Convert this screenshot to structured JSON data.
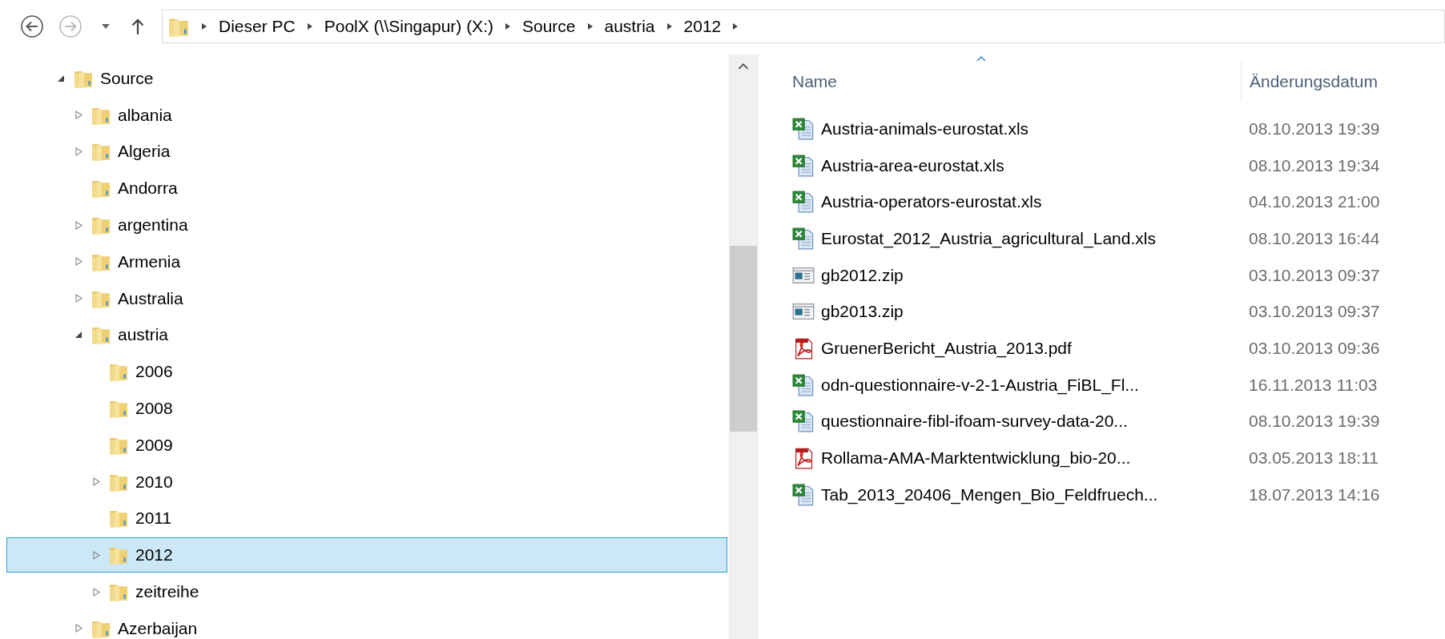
{
  "navigation": {
    "back": {
      "disabled": false
    },
    "forward": {
      "disabled": true
    }
  },
  "address_bar": {
    "crumbs": [
      "Dieser PC",
      "PoolX (\\\\Singapur) (X:)",
      "Source",
      "austria",
      "2012"
    ]
  },
  "tree": [
    {
      "name": "Source",
      "has_children": true,
      "expanded": true,
      "selected": false,
      "children": [
        {
          "name": "albania",
          "has_children": true,
          "expanded": false,
          "selected": false
        },
        {
          "name": "Algeria",
          "has_children": true,
          "expanded": false,
          "selected": false
        },
        {
          "name": "Andorra",
          "has_children": false,
          "selected": false
        },
        {
          "name": "argentina",
          "has_children": true,
          "expanded": false,
          "selected": false
        },
        {
          "name": "Armenia",
          "has_children": true,
          "expanded": false,
          "selected": false
        },
        {
          "name": "Australia",
          "has_children": true,
          "expanded": false,
          "selected": false
        },
        {
          "name": "austria",
          "has_children": true,
          "expanded": true,
          "selected": false,
          "children": [
            {
              "name": "2006",
              "has_children": false,
              "selected": false
            },
            {
              "name": "2008",
              "has_children": false,
              "selected": false
            },
            {
              "name": "2009",
              "has_children": false,
              "selected": false
            },
            {
              "name": "2010",
              "has_children": true,
              "expanded": false,
              "selected": false
            },
            {
              "name": "2011",
              "has_children": false,
              "selected": false
            },
            {
              "name": "2012",
              "has_children": true,
              "expanded": false,
              "selected": true
            },
            {
              "name": "zeitreihe",
              "has_children": true,
              "expanded": false,
              "selected": false
            }
          ]
        },
        {
          "name": "Azerbaijan",
          "has_children": true,
          "expanded": false,
          "selected": false
        }
      ]
    }
  ],
  "file_list": {
    "columns": [
      {
        "label": "Name",
        "sorted": true
      },
      {
        "label": "Änderungsdatum",
        "sorted": false
      }
    ],
    "rows": [
      {
        "name": "Austria-animals-eurostat.xls",
        "modified": "08.10.2013 19:39",
        "kind": "excel"
      },
      {
        "name": "Austria-area-eurostat.xls",
        "modified": "08.10.2013 19:34",
        "kind": "excel"
      },
      {
        "name": "Austria-operators-eurostat.xls",
        "modified": "04.10.2013 21:00",
        "kind": "excel"
      },
      {
        "name": "Eurostat_2012_Austria_agricultural_Land.xls",
        "modified": "08.10.2013 16:44",
        "kind": "excel"
      },
      {
        "name": "gb2012.zip",
        "modified": "03.10.2013 09:37",
        "kind": "zip"
      },
      {
        "name": "gb2013.zip",
        "modified": "03.10.2013 09:37",
        "kind": "zip"
      },
      {
        "name": "GruenerBericht_Austria_2013.pdf",
        "modified": "03.10.2013 09:36",
        "kind": "pdf"
      },
      {
        "name": "odn-questionnaire-v-2-1-Austria_FiBL_Fl...",
        "modified": "16.11.2013 11:03",
        "kind": "excel"
      },
      {
        "name": "questionnaire-fibl-ifoam-survey-data-20...",
        "modified": "08.10.2013 19:39",
        "kind": "excel"
      },
      {
        "name": "Rollama-AMA-Marktentwicklung_bio-20...",
        "modified": "03.05.2013 18:11",
        "kind": "pdf"
      },
      {
        "name": "Tab_2013_20406_Mengen_Bio_Feldfruech...",
        "modified": "18.07.2013 14:16",
        "kind": "excel"
      }
    ]
  }
}
